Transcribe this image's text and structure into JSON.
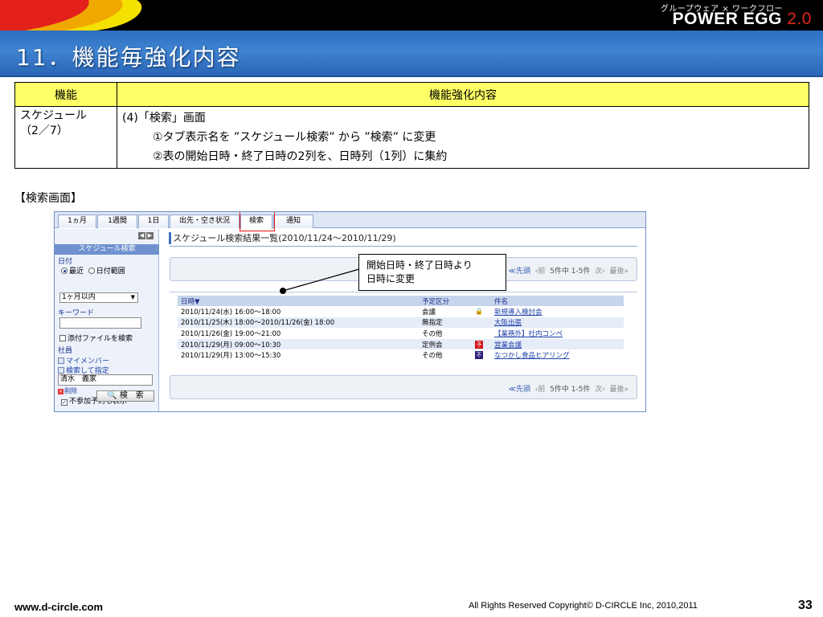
{
  "brand": {
    "tagline": "グループウェア × ワークフロー",
    "name": "POWER EGG",
    "version": "2.0"
  },
  "slide": {
    "title": "11．機能毎強化内容",
    "page_number": "33"
  },
  "feature_table": {
    "headers": [
      "機能",
      "機能強化内容"
    ],
    "row": {
      "feature_line1": "スケジュール",
      "feature_line2": "（2／7）",
      "content_heading": "(4)「検索」画面",
      "content_item1": "①タブ表示名を ”スケジュール検索” から ”検索” に変更",
      "content_item2": "②表の開始日時・終了日時の2列を、日時列（1列）に集約"
    }
  },
  "section_label": "【検索画面】",
  "screenshot": {
    "tabs": [
      "1ヵ月",
      "1週間",
      "1日",
      "出先・空き状況",
      "検索",
      "通知"
    ],
    "left_panel": {
      "nav_prev": "◀",
      "nav_next": "▶",
      "title": "スケジュール検索",
      "date_section": "日付",
      "radio_recent": "最近",
      "radio_range": "日付範囲",
      "period_select": "1ヶ月以内",
      "keyword_section": "キーワード",
      "attach_check": "添付ファイルを検索",
      "member_section": "社員",
      "my_members": "マイメンバー",
      "search_specify": "検索して指定",
      "member_value": "清水　義家",
      "delete_label": "削除",
      "show_absent": "不参加予約も表示",
      "search_button": "検　索"
    },
    "results": {
      "title": "スケジュール検索結果一覧(2010/11/24～2010/11/29)",
      "pager": {
        "first": "≪先頭",
        "prev": "‹前",
        "count": "5件中 1-5件",
        "next": "次›",
        "last": "最後»"
      },
      "columns": [
        "日時▼",
        "予定区分",
        "",
        "件名"
      ],
      "rows": [
        {
          "datetime": "2010/11/24(水) 16:00～18:00",
          "category": "会議",
          "icon": "lock-icon",
          "subject": "新規導入検討会"
        },
        {
          "datetime": "2010/11/25(木) 18:00～2010/11/26(金) 18:00",
          "category": "無指定",
          "icon": "",
          "subject": "大阪出張"
        },
        {
          "datetime": "2010/11/26(金) 19:00～21:00",
          "category": "その他",
          "icon": "",
          "subject": "【業務外】社内コンペ"
        },
        {
          "datetime": "2010/11/29(月) 09:00～10:30",
          "category": "定例会",
          "icon": "予",
          "subject": "営業会議"
        },
        {
          "datetime": "2010/11/29(月) 13:00～15:30",
          "category": "その他",
          "icon": "不",
          "subject": "なつかし食品ヒアリング"
        }
      ]
    }
  },
  "callout": {
    "line1": "開始日時・終了日時より",
    "line2": "日時に変更"
  },
  "footer": {
    "url": "www.d-circle.com",
    "copyright": "All Rights Reserved Copyright© D-CIRCLE  Inc, 2010,2011"
  },
  "colors": {
    "title_bar": "#3f83d1",
    "header_yellow": "#ffff66",
    "highlight_red": "#e11111",
    "brand_red": "#e0261b"
  }
}
